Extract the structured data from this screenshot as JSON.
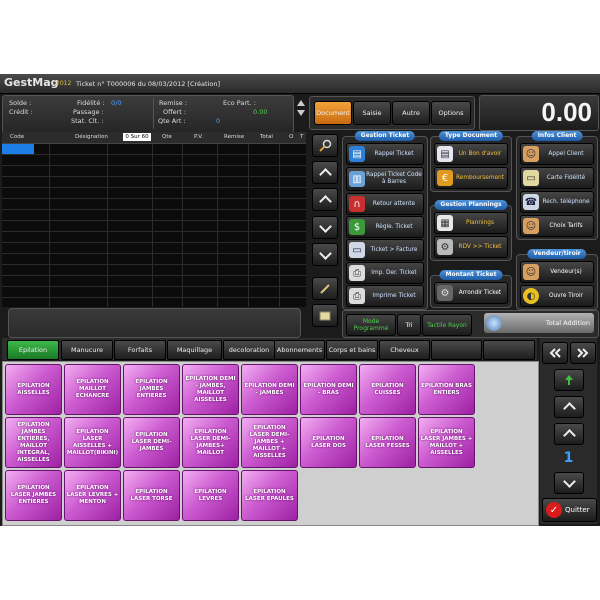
{
  "app": {
    "name": "GestMag",
    "year": "2012",
    "title": "Ticket n° T000006 du 08/03/2012   [Création]"
  },
  "info": {
    "solde": "Solde :",
    "credit": "Crédit :",
    "fidelite_label": "Fidélité :",
    "fidelite_value": "0/0",
    "passage": "Passage :",
    "stat": "Stat. Clt. :",
    "remise": "Remise :",
    "offert": "Offert :",
    "qte_art": "Qte Art :",
    "qte_art_value": "0",
    "eco_part": "Eco Part. :",
    "eco_part_value": "0.00"
  },
  "top_tabs": [
    {
      "label": "Document",
      "active": true
    },
    {
      "label": "Saisie",
      "active": false
    },
    {
      "label": "Autre",
      "active": false
    },
    {
      "label": "Options",
      "active": false
    }
  ],
  "total": "0.00",
  "grid": {
    "columns": [
      "Code",
      "Désignation",
      "Qte",
      "P.V.",
      "Remise",
      "Total",
      "O",
      "T"
    ],
    "sort_box": "0 Sur 60"
  },
  "groups": {
    "gestion_ticket": {
      "title": "Gestion Ticket",
      "buttons": [
        "Rappel Ticket",
        "Rappel Ticket Code à Barres",
        "Retour attente",
        "Règle. Ticket",
        "Ticket > Facture",
        "Imp. Der. Ticket",
        "Imprime Ticket"
      ]
    },
    "type_document": {
      "title": "Type Document",
      "buttons": [
        "Un Bon d'avoir",
        "Remboursement"
      ]
    },
    "gestion_plannings": {
      "title": "Gestion Plannings",
      "buttons": [
        "Plannings",
        "RDV >> Ticket"
      ]
    },
    "montant_ticket": {
      "title": "Montant Ticket",
      "buttons": [
        "Arrondir Ticket"
      ]
    },
    "infos_client": {
      "title": "Infos Client",
      "buttons": [
        "Appel Client",
        "Carte Fidélité",
        "Rech. téléphone",
        "Choix Tarifs"
      ]
    },
    "vendeur_tiroir": {
      "title": "Vendeur/tiroir",
      "buttons": [
        "Vendeur(s)",
        "Ouvre Tiroir"
      ]
    }
  },
  "mode_bar": {
    "mode": "Mode Programmé",
    "tri": "Tri",
    "tactile": "Tactile Rayon",
    "total_addition": "Total Addition"
  },
  "categories": [
    {
      "label": "Epilation",
      "active": true
    },
    {
      "label": "Manucure",
      "active": false
    },
    {
      "label": "Forfaits",
      "active": false
    },
    {
      "label": "Maquillage",
      "active": false
    },
    {
      "label": "decoloration",
      "active": false
    },
    {
      "label": "Abonnements",
      "active": false
    },
    {
      "label": "Corps et bains",
      "active": false
    },
    {
      "label": "Cheveux",
      "active": false
    },
    {
      "label": "",
      "active": false
    },
    {
      "label": "",
      "active": false
    }
  ],
  "products": [
    "EPILATION AISSELLES",
    "EPILATION MAILLOT ECHANCRE",
    "EPILATION JAMBES ENTIERES",
    "EPILATION DEMI - JAMBES, MAILLOT AISSELLES",
    "EPILATION DEMI - JAMBES",
    "EPILATION DEMI - BRAS",
    "EPILATION CUISSES",
    "EPILATION BRAS ENTIERS",
    "EPILATION JAMBES ENTIERES, MAILLOT INTEGRAL, AISSELLES",
    "EPILATION LASER AISSELLES + MAILLOT(BIKINI)",
    "EPILATION LASER DEMI-JAMBES",
    "EPILATION LASER DEMI-JAMBES+ MAILLOT",
    "EPILATION LASER DEMI-JAMBES + MAILLOT + AISSELLES",
    "EPILATION LASER DOS",
    "EPILATION LASER FESSES",
    "EPILATION LASER JAMBES + MAILLOT + AISSELLES",
    "EPILATION LASER JAMBES ENTIERES",
    "EPILATION LASER LEVRES + MENTON",
    "EPILATION LASER TORSE",
    "EPILATION LEVRES",
    "EPILATION LASER EPAULES"
  ],
  "nav": {
    "page": "1",
    "quit": "Quitter"
  }
}
